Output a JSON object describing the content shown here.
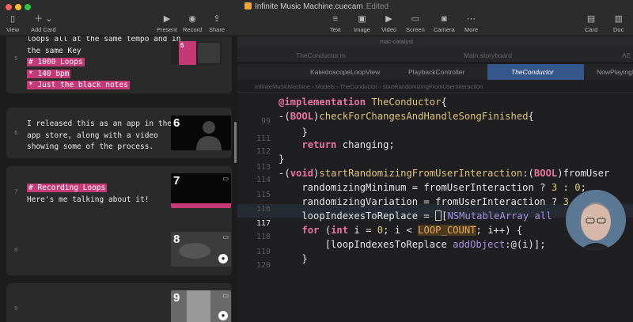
{
  "window": {
    "title": "Infinite Music Machine.cuecam",
    "status": "Edited"
  },
  "toolbar": {
    "left": [
      {
        "label": "View",
        "icon": "sidebar-icon",
        "glyph": "▯"
      },
      {
        "label": "Add Card",
        "icon": "plus-icon",
        "glyph": "＋ ⌄"
      }
    ],
    "center": [
      {
        "label": "Present",
        "icon": "play-icon",
        "glyph": "▶"
      },
      {
        "label": "Record",
        "icon": "record-icon",
        "glyph": "◉"
      },
      {
        "label": "Share",
        "icon": "share-icon",
        "glyph": "⇪"
      }
    ],
    "insert": [
      {
        "label": "Text",
        "icon": "text-icon",
        "glyph": "≡"
      },
      {
        "label": "Image",
        "icon": "image-icon",
        "glyph": "▣"
      },
      {
        "label": "Video",
        "icon": "video-icon",
        "glyph": "▶"
      },
      {
        "label": "Screen",
        "icon": "screen-icon",
        "glyph": "▭"
      },
      {
        "label": "Camera",
        "icon": "camera-icon",
        "glyph": "◙"
      },
      {
        "label": "More",
        "icon": "more-icon",
        "glyph": "⋯"
      }
    ],
    "right": [
      {
        "label": "Card",
        "icon": "card-icon",
        "glyph": "▤"
      },
      {
        "label": "Doc",
        "icon": "doc-icon",
        "glyph": "▥"
      }
    ]
  },
  "cards": [
    {
      "number": "5",
      "lines": [
        {
          "text": "loops all at the same tempo and in",
          "highlight": false
        },
        {
          "text": "the same Key",
          "highlight": false
        },
        {
          "text": "# 1000 Loops",
          "highlight": true
        },
        {
          "text": "* 140 bpm",
          "highlight": true
        },
        {
          "text": "* Just the black notes",
          "highlight": true
        }
      ],
      "thumb_number": "5"
    },
    {
      "number": "6",
      "lines": [
        {
          "text": "I released this as an app in the",
          "highlight": false
        },
        {
          "text": "app store, along with a video",
          "highlight": false
        },
        {
          "text": "showing some of the process.",
          "highlight": false
        }
      ],
      "thumb_number": "6"
    },
    {
      "number": "7",
      "lines": [
        {
          "text": "# Recording Loops",
          "highlight": true
        },
        {
          "text": "Here's me talking about it!",
          "highlight": false
        }
      ],
      "thumb_number": "7"
    },
    {
      "number": "8",
      "lines": [],
      "thumb_number": "8"
    },
    {
      "number": "9",
      "lines": [],
      "thumb_number": "9"
    }
  ],
  "editor": {
    "top_text": "mac-catalyst",
    "file_tabs": [
      "TheConductor.m",
      "Main.storyboard",
      "AE"
    ],
    "nav_tabs": [
      {
        "label": "KaleidoscopeLoopView",
        "active": false
      },
      {
        "label": "PlaybackController",
        "active": false
      },
      {
        "label": "TheConductor",
        "active": true
      },
      {
        "label": "NowPlayingL",
        "active": false
      }
    ],
    "breadcrumb": "InfiniteMusicMachine  ›  Models  ›  TheConductor  ›  startRandomizingFromUserInteraction",
    "line_numbers": [
      "99",
      "111",
      "112",
      "113",
      "114",
      "115",
      "116",
      "117",
      "118",
      "119",
      "120"
    ],
    "current_line": "117"
  },
  "colors": {
    "highlight": "#c43a77",
    "active_tab": "#35568a",
    "keyword": "#e9759e",
    "type": "#dfc47d"
  }
}
